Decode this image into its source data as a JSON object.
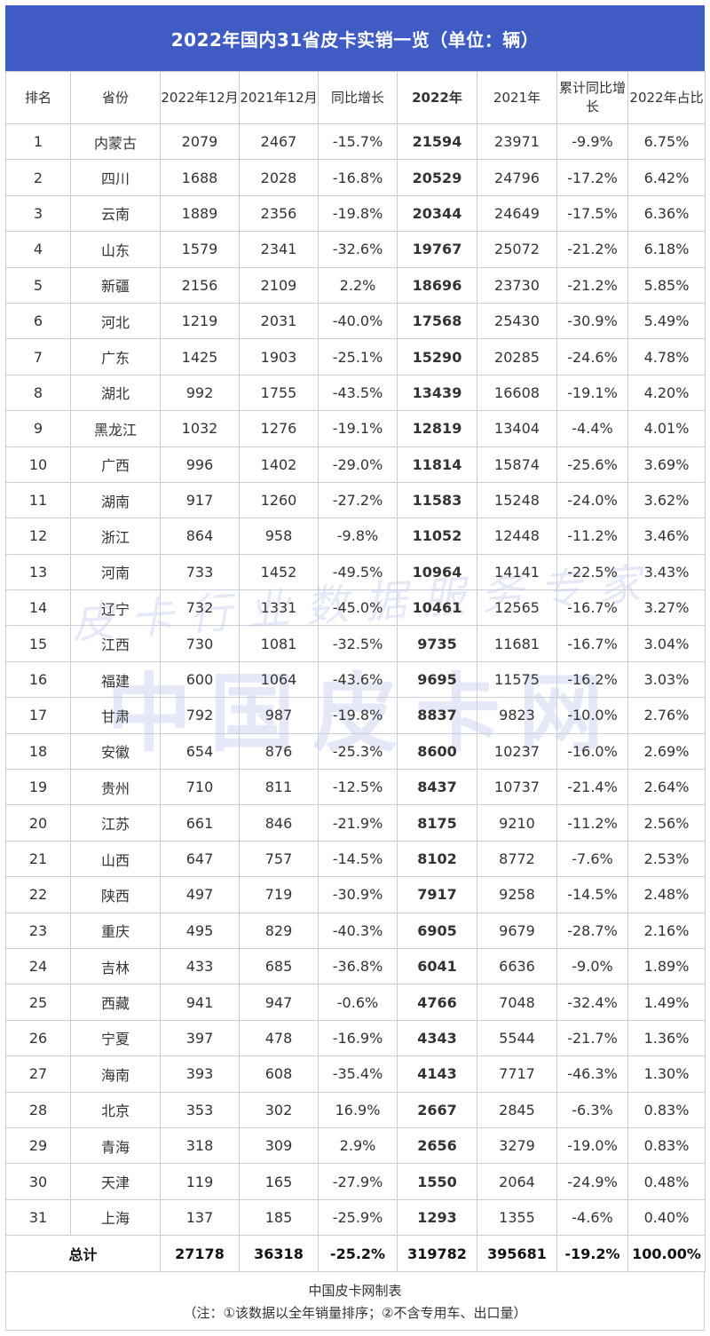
{
  "title": "2022年国内31省皮卡实销一览（单位：辆）",
  "watermark": {
    "line1": "皮卡行业数据服务专家",
    "line2": "中国皮卡网"
  },
  "headers": {
    "rank": "排名",
    "province": "省份",
    "dec_2022": "2022年12月",
    "dec_2021": "2021年12月",
    "yoy": "同比增长",
    "year_2022": "2022年",
    "year_2021": "2021年",
    "cum_yoy": "累计同比增长",
    "share_2022": "2022年占比"
  },
  "rows": [
    {
      "rank": "1",
      "province": "内蒙古",
      "dec_2022": "2079",
      "dec_2021": "2467",
      "yoy": "-15.7%",
      "year_2022": "21594",
      "year_2021": "23971",
      "cum_yoy": "-9.9%",
      "share": "6.75%"
    },
    {
      "rank": "2",
      "province": "四川",
      "dec_2022": "1688",
      "dec_2021": "2028",
      "yoy": "-16.8%",
      "year_2022": "20529",
      "year_2021": "24796",
      "cum_yoy": "-17.2%",
      "share": "6.42%"
    },
    {
      "rank": "3",
      "province": "云南",
      "dec_2022": "1889",
      "dec_2021": "2356",
      "yoy": "-19.8%",
      "year_2022": "20344",
      "year_2021": "24649",
      "cum_yoy": "-17.5%",
      "share": "6.36%"
    },
    {
      "rank": "4",
      "province": "山东",
      "dec_2022": "1579",
      "dec_2021": "2341",
      "yoy": "-32.6%",
      "year_2022": "19767",
      "year_2021": "25072",
      "cum_yoy": "-21.2%",
      "share": "6.18%"
    },
    {
      "rank": "5",
      "province": "新疆",
      "dec_2022": "2156",
      "dec_2021": "2109",
      "yoy": "2.2%",
      "year_2022": "18696",
      "year_2021": "23730",
      "cum_yoy": "-21.2%",
      "share": "5.85%"
    },
    {
      "rank": "6",
      "province": "河北",
      "dec_2022": "1219",
      "dec_2021": "2031",
      "yoy": "-40.0%",
      "year_2022": "17568",
      "year_2021": "25430",
      "cum_yoy": "-30.9%",
      "share": "5.49%"
    },
    {
      "rank": "7",
      "province": "广东",
      "dec_2022": "1425",
      "dec_2021": "1903",
      "yoy": "-25.1%",
      "year_2022": "15290",
      "year_2021": "20285",
      "cum_yoy": "-24.6%",
      "share": "4.78%"
    },
    {
      "rank": "8",
      "province": "湖北",
      "dec_2022": "992",
      "dec_2021": "1755",
      "yoy": "-43.5%",
      "year_2022": "13439",
      "year_2021": "16608",
      "cum_yoy": "-19.1%",
      "share": "4.20%"
    },
    {
      "rank": "9",
      "province": "黑龙江",
      "dec_2022": "1032",
      "dec_2021": "1276",
      "yoy": "-19.1%",
      "year_2022": "12819",
      "year_2021": "13404",
      "cum_yoy": "-4.4%",
      "share": "4.01%"
    },
    {
      "rank": "10",
      "province": "广西",
      "dec_2022": "996",
      "dec_2021": "1402",
      "yoy": "-29.0%",
      "year_2022": "11814",
      "year_2021": "15874",
      "cum_yoy": "-25.6%",
      "share": "3.69%"
    },
    {
      "rank": "11",
      "province": "湖南",
      "dec_2022": "917",
      "dec_2021": "1260",
      "yoy": "-27.2%",
      "year_2022": "11583",
      "year_2021": "15248",
      "cum_yoy": "-24.0%",
      "share": "3.62%"
    },
    {
      "rank": "12",
      "province": "浙江",
      "dec_2022": "864",
      "dec_2021": "958",
      "yoy": "-9.8%",
      "year_2022": "11052",
      "year_2021": "12448",
      "cum_yoy": "-11.2%",
      "share": "3.46%"
    },
    {
      "rank": "13",
      "province": "河南",
      "dec_2022": "733",
      "dec_2021": "1452",
      "yoy": "-49.5%",
      "year_2022": "10964",
      "year_2021": "14141",
      "cum_yoy": "-22.5%",
      "share": "3.43%"
    },
    {
      "rank": "14",
      "province": "辽宁",
      "dec_2022": "732",
      "dec_2021": "1331",
      "yoy": "-45.0%",
      "year_2022": "10461",
      "year_2021": "12565",
      "cum_yoy": "-16.7%",
      "share": "3.27%"
    },
    {
      "rank": "15",
      "province": "江西",
      "dec_2022": "730",
      "dec_2021": "1081",
      "yoy": "-32.5%",
      "year_2022": "9735",
      "year_2021": "11681",
      "cum_yoy": "-16.7%",
      "share": "3.04%"
    },
    {
      "rank": "16",
      "province": "福建",
      "dec_2022": "600",
      "dec_2021": "1064",
      "yoy": "-43.6%",
      "year_2022": "9695",
      "year_2021": "11575",
      "cum_yoy": "-16.2%",
      "share": "3.03%"
    },
    {
      "rank": "17",
      "province": "甘肃",
      "dec_2022": "792",
      "dec_2021": "987",
      "yoy": "-19.8%",
      "year_2022": "8837",
      "year_2021": "9823",
      "cum_yoy": "-10.0%",
      "share": "2.76%"
    },
    {
      "rank": "18",
      "province": "安徽",
      "dec_2022": "654",
      "dec_2021": "876",
      "yoy": "-25.3%",
      "year_2022": "8600",
      "year_2021": "10237",
      "cum_yoy": "-16.0%",
      "share": "2.69%"
    },
    {
      "rank": "19",
      "province": "贵州",
      "dec_2022": "710",
      "dec_2021": "811",
      "yoy": "-12.5%",
      "year_2022": "8437",
      "year_2021": "10737",
      "cum_yoy": "-21.4%",
      "share": "2.64%"
    },
    {
      "rank": "20",
      "province": "江苏",
      "dec_2022": "661",
      "dec_2021": "846",
      "yoy": "-21.9%",
      "year_2022": "8175",
      "year_2021": "9210",
      "cum_yoy": "-11.2%",
      "share": "2.56%"
    },
    {
      "rank": "21",
      "province": "山西",
      "dec_2022": "647",
      "dec_2021": "757",
      "yoy": "-14.5%",
      "year_2022": "8102",
      "year_2021": "8772",
      "cum_yoy": "-7.6%",
      "share": "2.53%"
    },
    {
      "rank": "22",
      "province": "陕西",
      "dec_2022": "497",
      "dec_2021": "719",
      "yoy": "-30.9%",
      "year_2022": "7917",
      "year_2021": "9258",
      "cum_yoy": "-14.5%",
      "share": "2.48%"
    },
    {
      "rank": "23",
      "province": "重庆",
      "dec_2022": "495",
      "dec_2021": "829",
      "yoy": "-40.3%",
      "year_2022": "6905",
      "year_2021": "9679",
      "cum_yoy": "-28.7%",
      "share": "2.16%"
    },
    {
      "rank": "24",
      "province": "吉林",
      "dec_2022": "433",
      "dec_2021": "685",
      "yoy": "-36.8%",
      "year_2022": "6041",
      "year_2021": "6636",
      "cum_yoy": "-9.0%",
      "share": "1.89%"
    },
    {
      "rank": "25",
      "province": "西藏",
      "dec_2022": "941",
      "dec_2021": "947",
      "yoy": "-0.6%",
      "year_2022": "4766",
      "year_2021": "7048",
      "cum_yoy": "-32.4%",
      "share": "1.49%"
    },
    {
      "rank": "26",
      "province": "宁夏",
      "dec_2022": "397",
      "dec_2021": "478",
      "yoy": "-16.9%",
      "year_2022": "4343",
      "year_2021": "5544",
      "cum_yoy": "-21.7%",
      "share": "1.36%"
    },
    {
      "rank": "27",
      "province": "海南",
      "dec_2022": "393",
      "dec_2021": "608",
      "yoy": "-35.4%",
      "year_2022": "4143",
      "year_2021": "7717",
      "cum_yoy": "-46.3%",
      "share": "1.30%"
    },
    {
      "rank": "28",
      "province": "北京",
      "dec_2022": "353",
      "dec_2021": "302",
      "yoy": "16.9%",
      "year_2022": "2667",
      "year_2021": "2845",
      "cum_yoy": "-6.3%",
      "share": "0.83%"
    },
    {
      "rank": "29",
      "province": "青海",
      "dec_2022": "318",
      "dec_2021": "309",
      "yoy": "2.9%",
      "year_2022": "2656",
      "year_2021": "3279",
      "cum_yoy": "-19.0%",
      "share": "0.83%"
    },
    {
      "rank": "30",
      "province": "天津",
      "dec_2022": "119",
      "dec_2021": "165",
      "yoy": "-27.9%",
      "year_2022": "1550",
      "year_2021": "2064",
      "cum_yoy": "-24.9%",
      "share": "0.48%"
    },
    {
      "rank": "31",
      "province": "上海",
      "dec_2022": "137",
      "dec_2021": "185",
      "yoy": "-25.9%",
      "year_2022": "1293",
      "year_2021": "1355",
      "cum_yoy": "-4.6%",
      "share": "0.40%"
    }
  ],
  "total": {
    "label": "总计",
    "dec_2022": "27178",
    "dec_2021": "36318",
    "yoy": "-25.2%",
    "year_2022": "319782",
    "year_2021": "395681",
    "cum_yoy": "-19.2%",
    "share": "100.00%"
  },
  "footer": {
    "source": "中国皮卡网制表",
    "note": "（注：①该数据以全年销量排序；②不含专用车、出口量）"
  },
  "colors": {
    "title_bg": "#3f5bc4",
    "negative": "#2e7d1e",
    "positive": "#e8141e",
    "border": "#c7cedd"
  }
}
